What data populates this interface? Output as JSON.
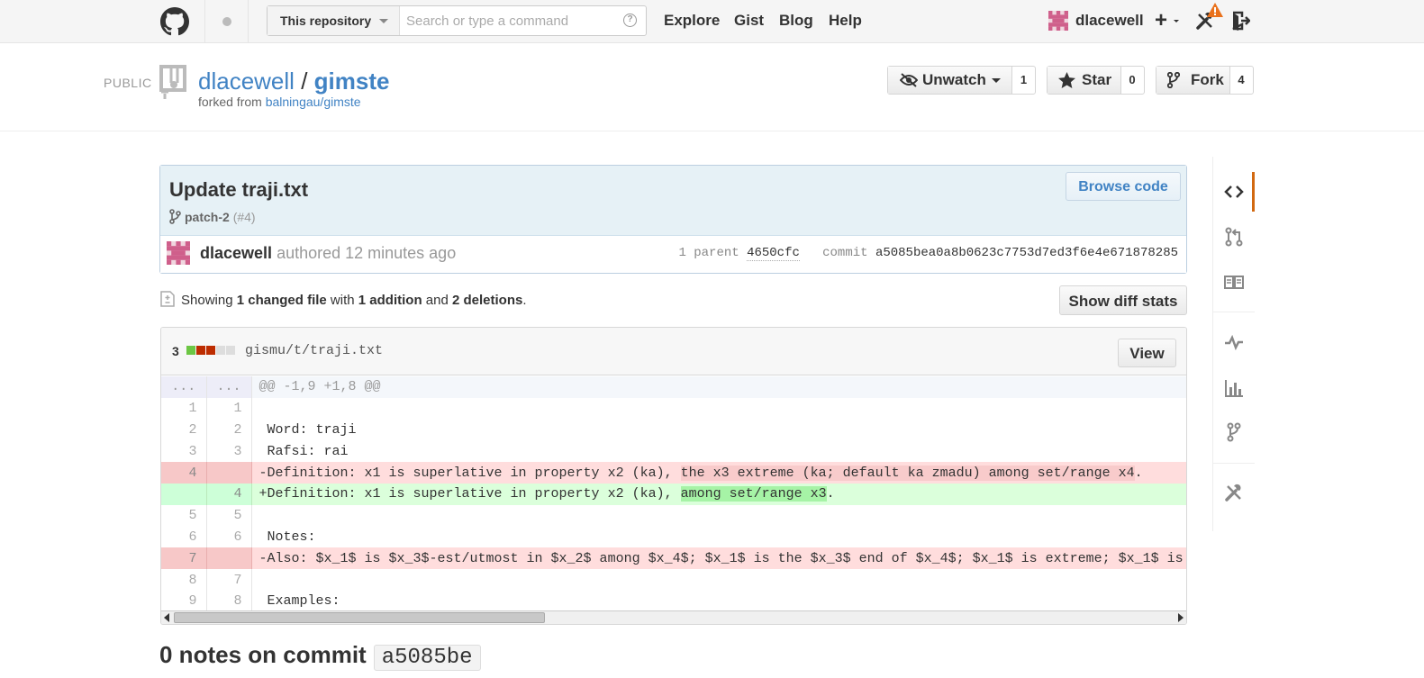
{
  "header": {
    "search_scope": "This repository",
    "search_placeholder": "Search or type a command",
    "nav": [
      "Explore",
      "Gist",
      "Blog",
      "Help"
    ],
    "username": "dlacewell",
    "plus": "+"
  },
  "repo": {
    "visibility": "PUBLIC",
    "owner": "dlacewell",
    "separator": "/",
    "name": "gimste",
    "forked_prefix": "forked from",
    "forked_source": "balningau/gimste",
    "unwatch_label": "Unwatch",
    "watch_count": "1",
    "star_label": "Star",
    "star_count": "0",
    "fork_label": "Fork",
    "fork_count": "4"
  },
  "commit": {
    "title": "Update traji.txt",
    "branch": "patch-2",
    "pr": "(#4)",
    "browse_label": "Browse code",
    "author": "dlacewell",
    "authored_text": "authored 12 minutes ago",
    "parent_label": "1 parent",
    "parent_sha": "4650cfc",
    "commit_label": "commit",
    "sha": "a5085bea0a8b0623c7753d7ed3f6e4e671878285"
  },
  "toc": {
    "showing": "Showing",
    "changed": "1 changed file",
    "with": "with",
    "additions": "1 addition",
    "and": "and",
    "deletions": "2 deletions",
    "period": ".",
    "diffstat_button": "Show diff stats"
  },
  "file": {
    "count": "3",
    "path": "gismu/t/traji.txt",
    "view_label": "View",
    "stat_colors": [
      "#6cc644",
      "#bd2c00",
      "#bd2c00",
      "#ddd",
      "#ddd"
    ],
    "lines": [
      {
        "type": "hunk",
        "old": "...",
        "new": "...",
        "text": "@@ -1,9 +1,8 @@"
      },
      {
        "type": "ctx",
        "old": "1",
        "new": "1",
        "text": " "
      },
      {
        "type": "ctx",
        "old": "2",
        "new": "2",
        "text": " Word: traji"
      },
      {
        "type": "ctx",
        "old": "3",
        "new": "3",
        "text": " Rafsi: rai"
      },
      {
        "type": "del",
        "old": "4",
        "new": "",
        "pre": "-Definition: x1 is superlative in property x2 (ka), ",
        "hl": "the x3 extreme (ka; default ka zmadu) among set/range x4",
        "post": "."
      },
      {
        "type": "add",
        "old": "",
        "new": "4",
        "pre": "+Definition: x1 is superlative in property x2 (ka), ",
        "hl": "among set/range x3",
        "post": "."
      },
      {
        "type": "ctx",
        "old": "5",
        "new": "5",
        "text": " "
      },
      {
        "type": "ctx",
        "old": "6",
        "new": "6",
        "text": " Notes:"
      },
      {
        "type": "del",
        "old": "7",
        "new": "",
        "text": "-Also: $x_1$ is $x_3$-est/utmost in $x_2$ among $x_4$; $x_1$ is the $x_3$ end of $x_4$; $x_1$ is extreme; $x_1$ is"
      },
      {
        "type": "ctx",
        "old": "8",
        "new": "7",
        "text": " "
      },
      {
        "type": "ctx",
        "old": "9",
        "new": "8",
        "text": " Examples:"
      }
    ]
  },
  "notes": {
    "title": "0 notes on commit",
    "sha": "a5085be"
  }
}
